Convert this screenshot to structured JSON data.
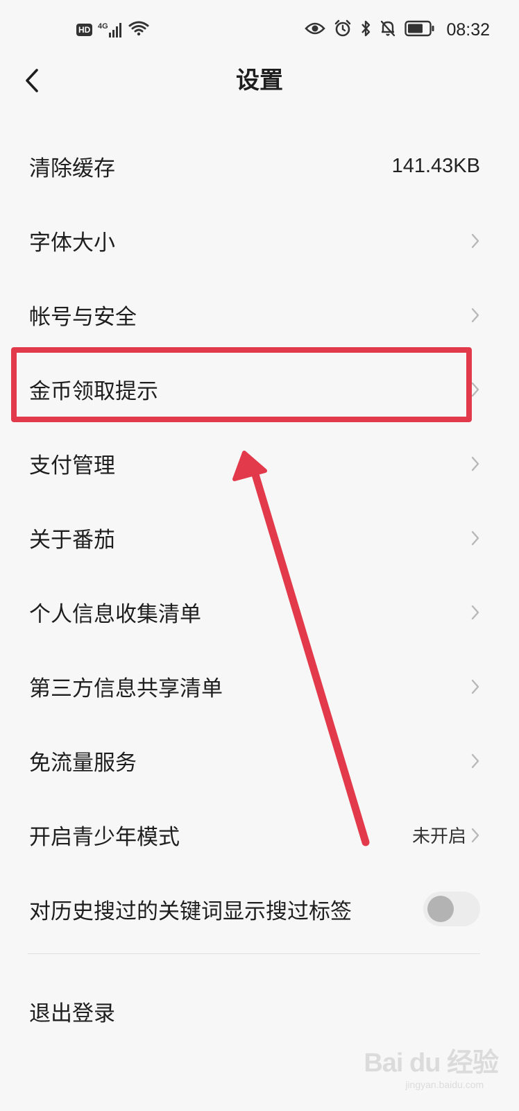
{
  "status_bar": {
    "hd_label": "HD",
    "network_label": "4G",
    "time": "08:32"
  },
  "nav": {
    "title": "设置"
  },
  "settings": {
    "items": [
      {
        "label": "清除缓存",
        "value": "141.43KB",
        "has_chevron": false
      },
      {
        "label": "字体大小",
        "value": "",
        "has_chevron": true
      },
      {
        "label": "帐号与安全",
        "value": "",
        "has_chevron": true
      },
      {
        "label": "金币领取提示",
        "value": "",
        "has_chevron": true
      },
      {
        "label": "支付管理",
        "value": "",
        "has_chevron": true
      },
      {
        "label": "关于番茄",
        "value": "",
        "has_chevron": true
      },
      {
        "label": "个人信息收集清单",
        "value": "",
        "has_chevron": true
      },
      {
        "label": "第三方信息共享清单",
        "value": "",
        "has_chevron": true
      },
      {
        "label": "免流量服务",
        "value": "",
        "has_chevron": true
      },
      {
        "label": "开启青少年模式",
        "value": "未开启",
        "has_chevron": true
      },
      {
        "label": "对历史搜过的关键词显示搜过标签",
        "value": "",
        "has_chevron": false,
        "toggle_on": false
      }
    ]
  },
  "logout": {
    "label": "退出登录"
  },
  "watermark": {
    "text": "Bai du 经验",
    "sub": "jingyan.baidu.com"
  },
  "colors": {
    "background": "#f7f7f7",
    "highlight": "#e23a4b",
    "text": "#1e1e1e",
    "chevron": "#b8b8b8"
  },
  "icons": [
    "hd-icon",
    "signal-icon",
    "wifi-icon",
    "eye-icon",
    "alarm-icon",
    "bluetooth-icon",
    "mute-icon",
    "battery-icon",
    "back-arrow-icon",
    "chevron-right-icon"
  ]
}
